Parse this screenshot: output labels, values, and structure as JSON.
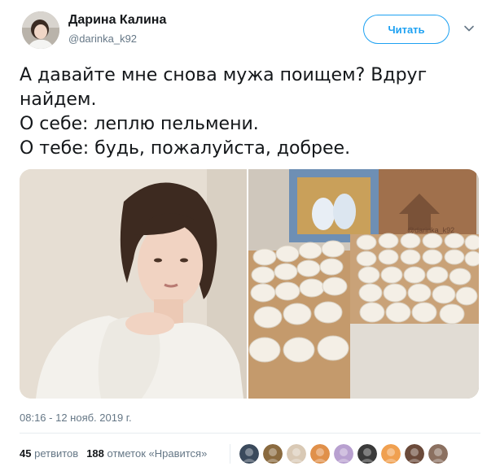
{
  "author": {
    "name": "Дарина Калина",
    "handle": "@darinka_k92"
  },
  "follow_button": {
    "label": "Читать"
  },
  "tweet": {
    "lines": [
      "А давайте мне снова мужа поищем? Вдруг",
      "найдем.",
      "О себе: леплю пельмени.",
      "О тебе: будь, пожалуйста, добрее."
    ]
  },
  "media": {
    "watermark": "@darinka_k92"
  },
  "timestamp": "08:16 - 12 нояб. 2019 г.",
  "stats": {
    "retweets_count": "45",
    "retweets_label": "ретвитов",
    "likes_count": "188",
    "likes_label": "отметок «Нравится»"
  },
  "likers": {
    "colors": [
      "#3b4a5c",
      "#8a6a3f",
      "#d9c9b5",
      "#e0904a",
      "#b8a0d0",
      "#3a3a3a",
      "#f0a050",
      "#6b4a3a",
      "#8b7060"
    ]
  }
}
